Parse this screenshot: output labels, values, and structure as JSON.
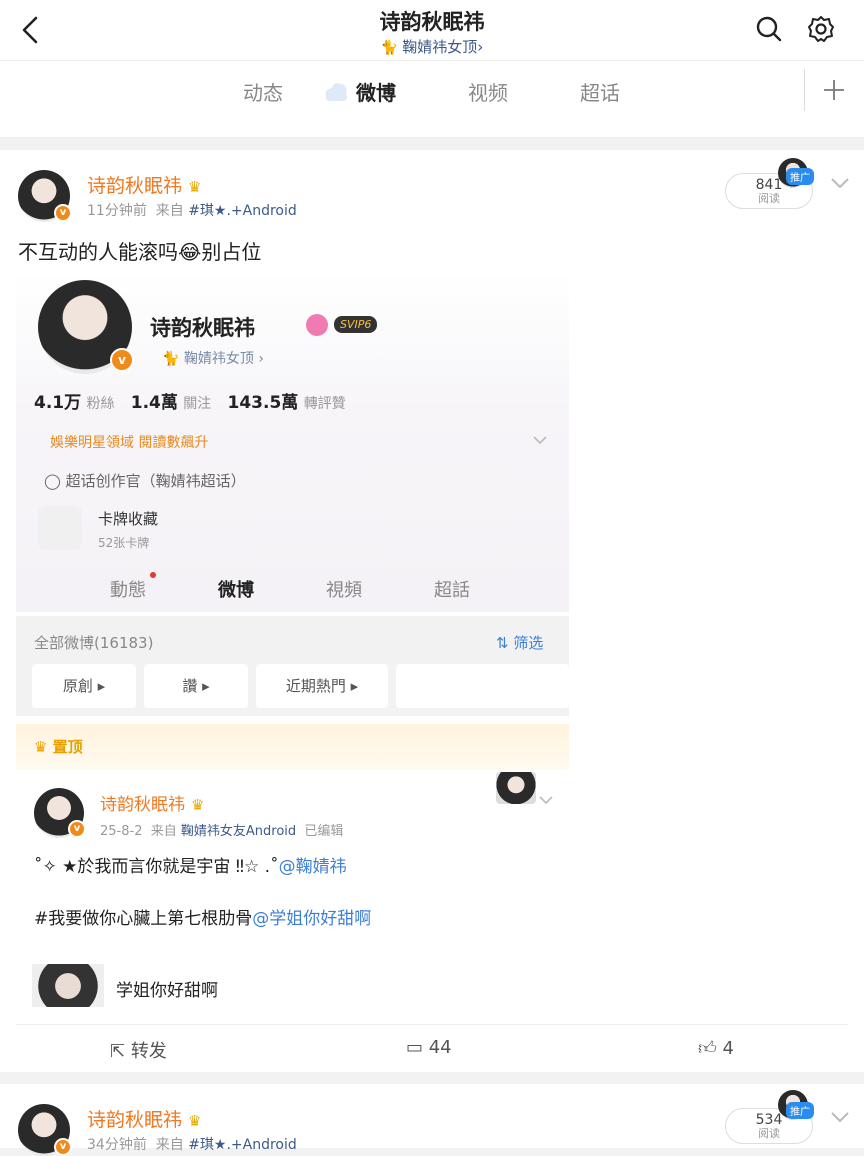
{
  "header": {
    "title": "诗韵秋眠祎",
    "subtitle": "鞠婧祎女顶",
    "subtitle_arrow": "›",
    "icons": [
      "back-icon",
      "search-icon",
      "gear-icon"
    ]
  },
  "tabs": [
    {
      "label": "动态"
    },
    {
      "label": "微博",
      "active": true
    },
    {
      "label": "视频"
    },
    {
      "label": "超话"
    }
  ],
  "post1": {
    "name": "诗韵秋眠祎",
    "time": "11分钟前",
    "from_label": "来自",
    "source": "#琪★.+Android",
    "reads": "841",
    "reads_label": "阅读",
    "promo_label": "推广",
    "text": "不互动的人能滚吗😂别占位",
    "screenshot": {
      "name": "诗韵秋眠祎",
      "vip": "SVIP6",
      "sub": "鞠婧祎女顶 ›",
      "fans_num": "4.1万",
      "fans_label": "粉絲",
      "follow_num": "1.4萬",
      "follow_label": "關注",
      "repost_num": "143.5萬",
      "repost_label": "轉評贊",
      "star_line": "娛樂明星領域 閱讀數飆升",
      "creator": "超话创作官（鞠婧祎超话）",
      "card_title": "卡牌收藏",
      "card_sub": "52张卡牌",
      "tabs": [
        "動態",
        "微博",
        "視頻",
        "超話"
      ],
      "all_count": "全部微博(16183)",
      "filter": "筛选",
      "chips": [
        "原創 ▸",
        "讚 ▸",
        "近期熱門 ▸"
      ],
      "pinned": "置顶",
      "inner_name": "诗韵秋眠祎",
      "inner_date": "25-8-2",
      "inner_from": "来自",
      "inner_source": "鞠婧祎女友Android",
      "inner_edited": "已编辑",
      "inner_line1": "˚✧ ★於我而言你就是宇宙 ‼☆ .˚",
      "inner_mention1": "@鞠婧祎",
      "inner_line2": "#我要做你心臟上第七根肋骨",
      "inner_mention2": "@学姐你好甜啊",
      "inner_card_title": "学姐你好甜啊"
    },
    "repost_label": "转发",
    "comments": "44",
    "likes": "4"
  },
  "post2": {
    "name": "诗韵秋眠祎",
    "time": "34分钟前",
    "from_label": "来自",
    "source": "#琪★.+Android",
    "reads": "534",
    "reads_label": "阅读",
    "promo_label": "推广"
  }
}
